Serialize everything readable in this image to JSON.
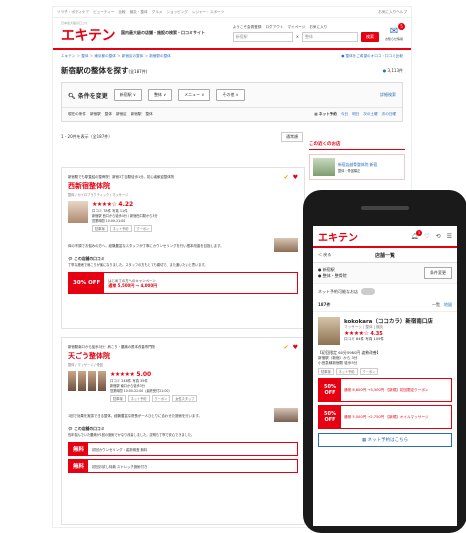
{
  "desktop": {
    "topbar_links": [
      "ソラ子・ボディケア",
      "ビューティー",
      "比較",
      "鍼灸・整体",
      "グルメ",
      "ショッピング",
      "レジャー・スポーツ"
    ],
    "topbar_right": "お気に入りヘルプ",
    "logo": "エキテン",
    "logo_sub": "日本最大級の口コミ",
    "tagline": "国内最大級の店舗・施設の検索・口コミサイト",
    "login_links": [
      "ようこそ会員登録",
      "ログアウト",
      "マイページ",
      "お気に入り"
    ],
    "area_field": "新宿駅",
    "keyword_field": "整体",
    "search_button": "検索",
    "notify_badge": "5",
    "notify_label": "お知らせ情報",
    "breadcrumb": "エキテン ＞ 整体 ＞ 東京都の整体 ＞ 新宿区の整体 ＞ 新宿駅の整体",
    "breadcrumb_right": "● 整体をご希望のオロコ・口コミ比較",
    "page_title": "新宿駅の整体を探す",
    "page_title_count": "(全187件)",
    "result_count": "3,113件",
    "filter_title": "条件を変更",
    "filter_dropdowns": [
      "新宿駅 ∨",
      "整体 ∨",
      "メニュー ∨",
      "その他 ∨"
    ],
    "filter_detail": "詳細検索",
    "filter_row2_label": "現在の条件",
    "filter_row2_items": [
      "新宿駅",
      "整体",
      "新宿区",
      "新宿駅",
      "整体"
    ],
    "net_reserve": "ネット予約",
    "net_reserve_links": [
      "今日",
      "明日",
      "次の土曜",
      "次の日曜"
    ],
    "list_count": "1 - 20件を表示（全187件）",
    "sort_label": "表示件数",
    "sort_value": "通常順",
    "side_title": "この近くのお店",
    "side_shop": "新宿店越骨整体院 新宿",
    "side_shop_sub": "整体・骨盤矯正",
    "card1": {
      "category": "新宿駅でも駅直結の整骨院！新宿3丁目駅徒歩1分。初心者歓迎整体院",
      "name": "西新宿整体院",
      "sub": "整体 / カイロプラクティック / マッサージ",
      "stars": "★★★★☆",
      "rating": "4.22",
      "reviews": "口コミ 78件  写真 11件",
      "access1": "新宿駅 西口から徒歩4分 / 新宿西口駅から3分",
      "access2": "営業時間 10:00-21:00",
      "tags": [
        "駐車場",
        "ネット予約",
        "クーポン"
      ],
      "desc": "体の不調でお悩みの方へ。経験豊富なスタッフが丁寧にカウンセリングを行い根本改善を目指します。",
      "review_title": "この店舗の口コミ",
      "review_text": "丁寧な施術で肩こりが楽になりました。スタッフの方もとても親切で、また通いたいと思います。",
      "promo_label": "30% OFF",
      "promo_text1": "はじめての方へのキャンペーン",
      "promo_text2": "通常 5,500円 → 4,000円"
    },
    "card2": {
      "category": "新宿駅南口から徒歩3分！肩こり・腰痛の根本改善専門院",
      "name": "天ごう整体院",
      "sub": "整体 / マッサージ / 骨盤",
      "stars": "★★★★★",
      "rating": "5.00",
      "reviews": "口コミ 248件  写真 35件",
      "access1": "新宿駅 南口から徒歩3分",
      "access2": "営業時間 10:00-22:00（最終受付21:00）",
      "tags": [
        "駐車場",
        "ネット予約",
        "クーポン",
        "女性スタッフ"
      ],
      "desc": "1回で効果を実感できる整体。経験豊富な院長が一人ひとりに合わせた施術を行います。",
      "review_title": "この店舗の口コミ",
      "review_text": "長年悩んでいた腰痛が1回の施術でかなり改善しました。説明も丁寧で安心できました。",
      "promo_rows": [
        {
          "label": "無料",
          "text": "初回カウンセリング・姿勢検査 無料"
        },
        {
          "label": "無料",
          "text": "初回お試し特典 ストレッチ施術付き"
        }
      ]
    }
  },
  "phone": {
    "logo": "エキテン",
    "badge": "5",
    "icons": [
      "お知らせ",
      "お気に入り",
      "閲覧履歴",
      "メニュー"
    ],
    "back": "＜ 戻る",
    "title": "店舗一覧",
    "cond_line1": "新宿駅",
    "cond_line2": "整体・整骨院",
    "cond_btn": "条件変更",
    "net_label": "ネット予約可能なお店",
    "count": "187件",
    "sort": "一覧",
    "map": "地図",
    "shop_name": "kokokara（ココカラ）新宿南口店",
    "shop_sub": "マッサージ | 整体 | 鍼灸",
    "stars": "★★★★☆",
    "rating": "4.35",
    "reviews": "口コミ 84件  写真 109件",
    "hours": "【初回限定 60分5980円 姿勢改善】",
    "access1": "新宿駅（新宿）から 3分",
    "access2": "小田急線新宿駅 徒歩5分",
    "tags": [
      "駐車場",
      "ネット予約",
      "クーポン"
    ],
    "coupon1_label": "50% OFF",
    "coupon1_text": "通常 6,600円 →3,300円 【新規】初回限定クーポン",
    "coupon2_label": "50% OFF",
    "coupon2_text": "通常 5,500円 →2,750円 【新規】オイルマッサージ",
    "reserve_btn": "ネット予約はこちら"
  },
  "colors": {
    "brand": "#e60012"
  }
}
